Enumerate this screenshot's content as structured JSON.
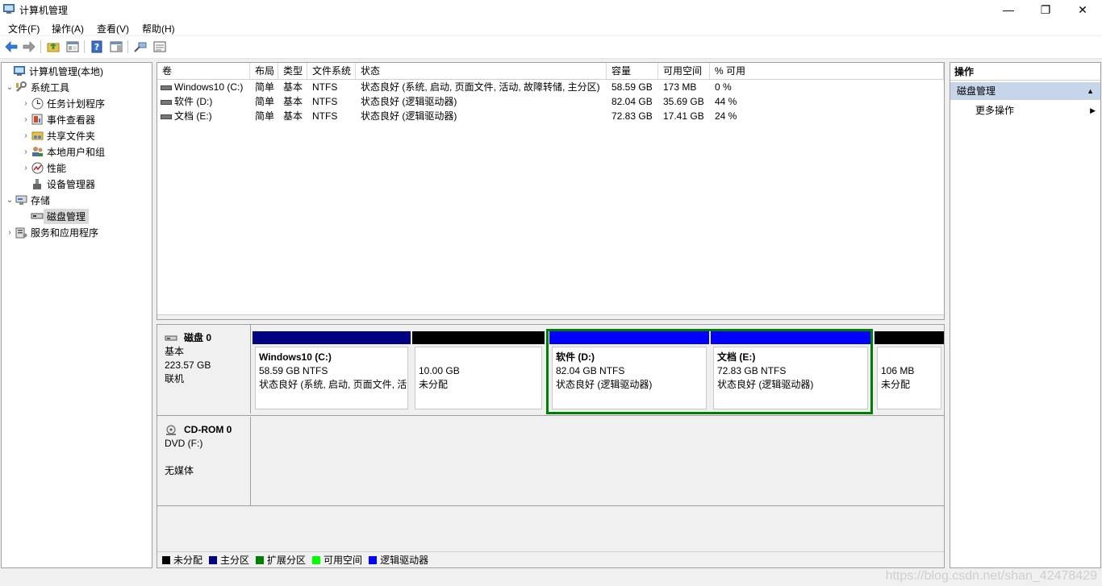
{
  "window": {
    "title": "计算机管理",
    "controls": {
      "minimize": "—",
      "maximize": "❐",
      "close": "✕"
    }
  },
  "menu": [
    {
      "label": "文件(F)"
    },
    {
      "label": "操作(A)"
    },
    {
      "label": "查看(V)"
    },
    {
      "label": "帮助(H)"
    }
  ],
  "toolbar": {
    "buttons": [
      "back-arrow-icon",
      "forward-arrow-icon",
      "up-folder-icon",
      "show-hide-tree-icon",
      "help-icon",
      "show-action-pane-icon",
      "connect-icon",
      "properties-icon"
    ]
  },
  "tree": [
    {
      "label": "计算机管理(本地)",
      "icon": "computer-management-icon",
      "chev": ""
    },
    {
      "label": "系统工具",
      "icon": "system-tools-icon",
      "chev": "⌄"
    },
    {
      "label": "任务计划程序",
      "icon": "task-scheduler-icon",
      "chev": "›"
    },
    {
      "label": "事件查看器",
      "icon": "event-viewer-icon",
      "chev": "›"
    },
    {
      "label": "共享文件夹",
      "icon": "shared-folders-icon",
      "chev": "›"
    },
    {
      "label": "本地用户和组",
      "icon": "local-users-icon",
      "chev": "›"
    },
    {
      "label": "性能",
      "icon": "performance-icon",
      "chev": "›"
    },
    {
      "label": "设备管理器",
      "icon": "device-manager-icon",
      "chev": ""
    },
    {
      "label": "存储",
      "icon": "storage-icon",
      "chev": "⌄"
    },
    {
      "label": "磁盘管理",
      "icon": "disk-management-icon",
      "chev": ""
    },
    {
      "label": "服务和应用程序",
      "icon": "services-apps-icon",
      "chev": "›"
    }
  ],
  "volumes": {
    "columns": [
      "卷",
      "布局",
      "类型",
      "文件系统",
      "状态",
      "容量",
      "可用空间",
      "% 可用"
    ],
    "rows": [
      [
        "Windows10 (C:)",
        "简单",
        "基本",
        "NTFS",
        "状态良好 (系统, 启动, 页面文件, 活动, 故障转储, 主分区)",
        "58.59 GB",
        "173 MB",
        "0 %"
      ],
      [
        "软件 (D:)",
        "简单",
        "基本",
        "NTFS",
        "状态良好 (逻辑驱动器)",
        "82.04 GB",
        "35.69 GB",
        "44 %"
      ],
      [
        "文档 (E:)",
        "简单",
        "基本",
        "NTFS",
        "状态良好 (逻辑驱动器)",
        "72.83 GB",
        "17.41 GB",
        "24 %"
      ]
    ]
  },
  "disks": {
    "disk0": {
      "name": "磁盘 0",
      "type": "基本",
      "size": "223.57 GB",
      "status": "联机",
      "partitions": [
        {
          "name": "Windows10  (C:)",
          "size": "58.59 GB NTFS",
          "status": "状态良好 (系统, 启动, 页面文件, 活动, 故障转储, 主分区)",
          "kind": "primary"
        },
        {
          "name": "",
          "size": "10.00 GB",
          "status": "未分配",
          "kind": "unallocated"
        },
        {
          "name": "软件  (D:)",
          "size": "82.04 GB NTFS",
          "status": "状态良好 (逻辑驱动器)",
          "kind": "logical"
        },
        {
          "name": "文档  (E:)",
          "size": "72.83 GB NTFS",
          "status": "状态良好 (逻辑驱动器)",
          "kind": "logical"
        },
        {
          "name": "",
          "size": "106 MB",
          "status": "未分配",
          "kind": "unallocated"
        }
      ]
    },
    "cdrom0": {
      "name": "CD-ROM 0",
      "type": "DVD (F:)",
      "status": "无媒体"
    }
  },
  "legend": [
    {
      "label": "未分配",
      "color": "#000000"
    },
    {
      "label": "主分区",
      "color": "#000080"
    },
    {
      "label": "扩展分区",
      "color": "#008000"
    },
    {
      "label": "可用空间",
      "color": "#00ff00"
    },
    {
      "label": "逻辑驱动器",
      "color": "#0000ff"
    }
  ],
  "actions": {
    "title": "操作",
    "section": "磁盘管理",
    "item": "更多操作"
  },
  "watermark": "https://blog.csdn.net/shan_42478429"
}
